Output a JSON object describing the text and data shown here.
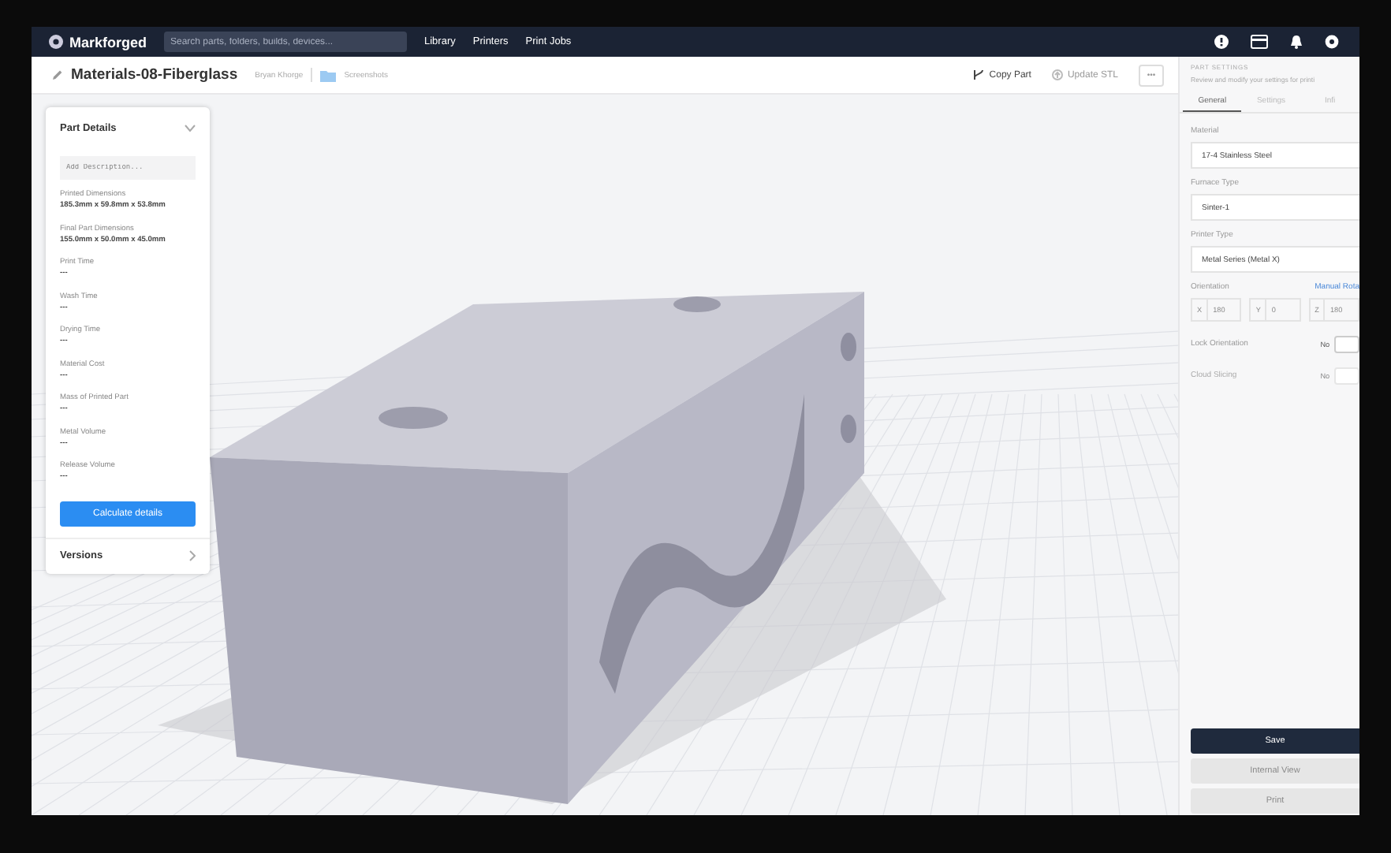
{
  "nav": {
    "brand": "Markforged",
    "search": {
      "placeholder": "Search parts, folders, builds, devices..."
    },
    "links": [
      "Library",
      "Printers",
      "Print Jobs"
    ]
  },
  "header": {
    "title": "Materials-08-Fiberglass",
    "owner": "Bryan Khorge",
    "folder": "Screenshots",
    "actions": [
      {
        "label": "Copy Part",
        "disabled": false
      },
      {
        "label": "Update STL",
        "disabled": true
      }
    ],
    "more": "•••"
  },
  "part_details": {
    "title": "Part Details",
    "expanded": true,
    "description": {
      "placeholder": "Add Description..."
    },
    "items": [
      {
        "label": "Printed Dimensions",
        "value": "185.3mm x 59.8mm x 53.8mm"
      },
      {
        "label": "Final Part Dimensions",
        "value": "155.0mm x 50.0mm x 45.0mm"
      },
      {
        "label": "Print Time",
        "value": "---"
      },
      {
        "label": "Wash Time",
        "value": "---"
      },
      {
        "label": "Drying Time",
        "value": "---"
      },
      {
        "label": "Material Cost",
        "value": "---"
      },
      {
        "label": "Mass of Printed Part",
        "value": "---"
      },
      {
        "label": "Metal Volume",
        "value": "---"
      },
      {
        "label": "Release Volume",
        "value": "---"
      }
    ],
    "button": "Calculate details",
    "versions": "Versions"
  },
  "part_settings": {
    "title": "PART SETTINGS",
    "subtitle": "Review and modify your settings for printi",
    "tabs": [
      {
        "label": "General",
        "selected": true
      },
      {
        "label": "Settings",
        "selected": false
      },
      {
        "label": "Infi",
        "selected": false
      }
    ],
    "selects": [
      {
        "label": "Material",
        "value": "17-4 Stainless Steel"
      },
      {
        "label": "Furnace Type",
        "value": "Sinter-1"
      },
      {
        "label": "Printer Type",
        "value": "Metal Series (Metal X)"
      }
    ],
    "orientation": {
      "label": "Orientation",
      "link": "Manual Rota",
      "axes": [
        {
          "axis": "X",
          "value": "180"
        },
        {
          "axis": "Y",
          "value": "0"
        },
        {
          "axis": "Z",
          "value": "180"
        }
      ]
    },
    "toggles": [
      {
        "label": "Lock Orientation",
        "value": "No",
        "disabled": false,
        "checked": false
      },
      {
        "label": "Cloud Slicing",
        "value": "No",
        "disabled": true,
        "checked": false
      }
    ],
    "buttons": [
      {
        "label": "Save",
        "disabled": false
      },
      {
        "label": "Internal View",
        "disabled": true
      },
      {
        "label": "Print",
        "disabled": true
      }
    ]
  }
}
